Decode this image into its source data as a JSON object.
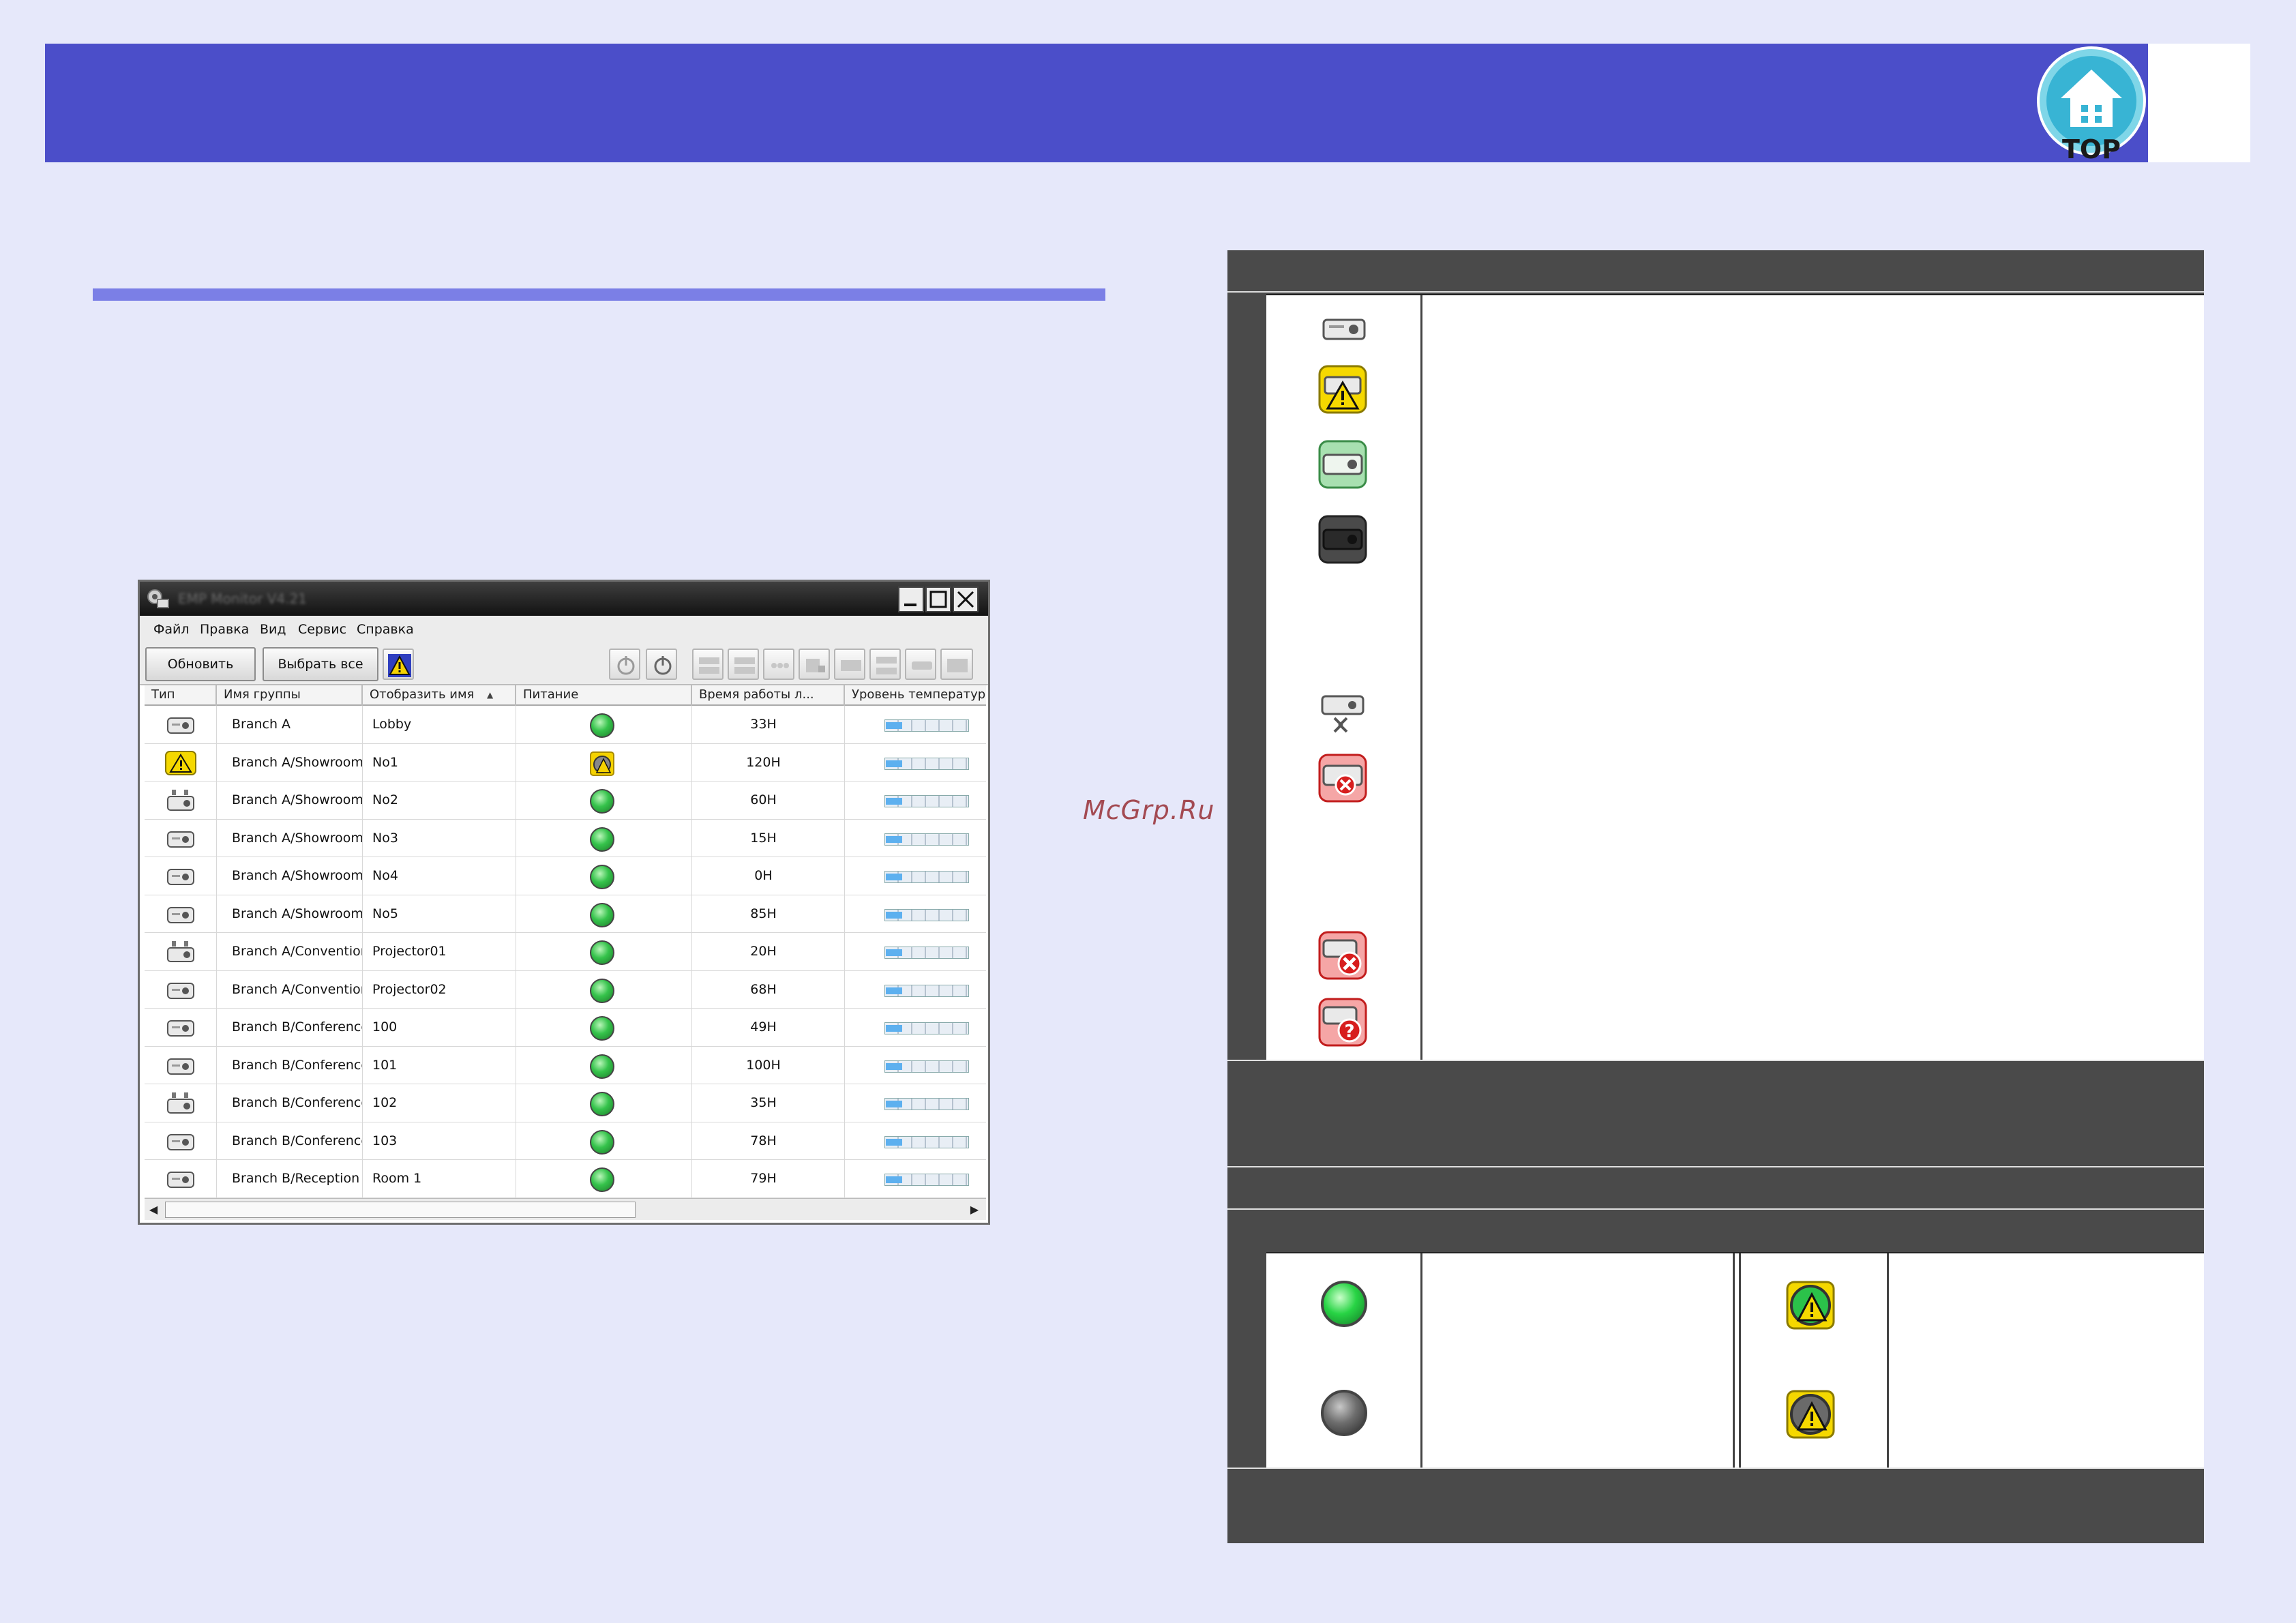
{
  "header": {
    "top_button_label": "TOP"
  },
  "watermark": "McGrp.Ru",
  "app_window": {
    "title": "EMP Monitor V4.21",
    "menu": [
      "Файл",
      "Правка",
      "Вид",
      "Сервис",
      "Справка"
    ],
    "toolbar": {
      "refresh_label": "Обновить",
      "select_all_label": "Выбрать все"
    },
    "columns": [
      "Тип",
      "Имя группы",
      "Отобразить имя",
      "Питание",
      "Время работы л...",
      "Уровень температур"
    ],
    "rows": [
      {
        "type": "projector",
        "group": "Branch A",
        "display_name": "Lobby",
        "power": "on",
        "hours": "33H"
      },
      {
        "type": "warning",
        "group": "Branch A/Showroom/",
        "display_name": "No1",
        "power": "warning",
        "hours": "120H"
      },
      {
        "type": "projector-network",
        "group": "Branch A/Showroom/",
        "display_name": "No2",
        "power": "on",
        "hours": "60H"
      },
      {
        "type": "projector",
        "group": "Branch A/Showroom/",
        "display_name": "No3",
        "power": "on",
        "hours": "15H"
      },
      {
        "type": "projector",
        "group": "Branch A/Showroom/",
        "display_name": "No4",
        "power": "on",
        "hours": "0H"
      },
      {
        "type": "projector",
        "group": "Branch A/Showroom/",
        "display_name": "No5",
        "power": "on",
        "hours": "85H"
      },
      {
        "type": "projector-network",
        "group": "Branch A/Conventior",
        "display_name": "Projector01",
        "power": "on",
        "hours": "20H"
      },
      {
        "type": "projector",
        "group": "Branch A/Conventior",
        "display_name": "Projector02",
        "power": "on",
        "hours": "68H"
      },
      {
        "type": "projector",
        "group": "Branch B/Conference",
        "display_name": "100",
        "power": "on",
        "hours": "49H"
      },
      {
        "type": "projector",
        "group": "Branch B/Conference",
        "display_name": "101",
        "power": "on",
        "hours": "100H"
      },
      {
        "type": "projector-network",
        "group": "Branch B/Conference",
        "display_name": "102",
        "power": "on",
        "hours": "35H"
      },
      {
        "type": "projector",
        "group": "Branch B/Conference",
        "display_name": "103",
        "power": "on",
        "hours": "78H"
      },
      {
        "type": "projector",
        "group": "Branch B/Reception",
        "display_name": "Room 1",
        "power": "on",
        "hours": "79H"
      }
    ],
    "temp_level_fraction": 0.2
  },
  "legend": {
    "type_icons": [
      "projector-icon",
      "projector-warning-icon",
      "projector-green-icon",
      "projector-dark-icon",
      "projector-linked-icon",
      "projector-disconnect-icon",
      "projector-error-icon",
      "projector-unknown-icon"
    ],
    "power_icons": [
      "power-on-led-icon",
      "power-off-led-icon",
      "power-on-warning-icon",
      "power-off-warning-icon"
    ]
  },
  "colors": {
    "header": "#4b4ec9",
    "accent_rule": "#7b7fe6",
    "page_bg": "#e6e8fa",
    "panel_dark": "#4a4a4a"
  }
}
